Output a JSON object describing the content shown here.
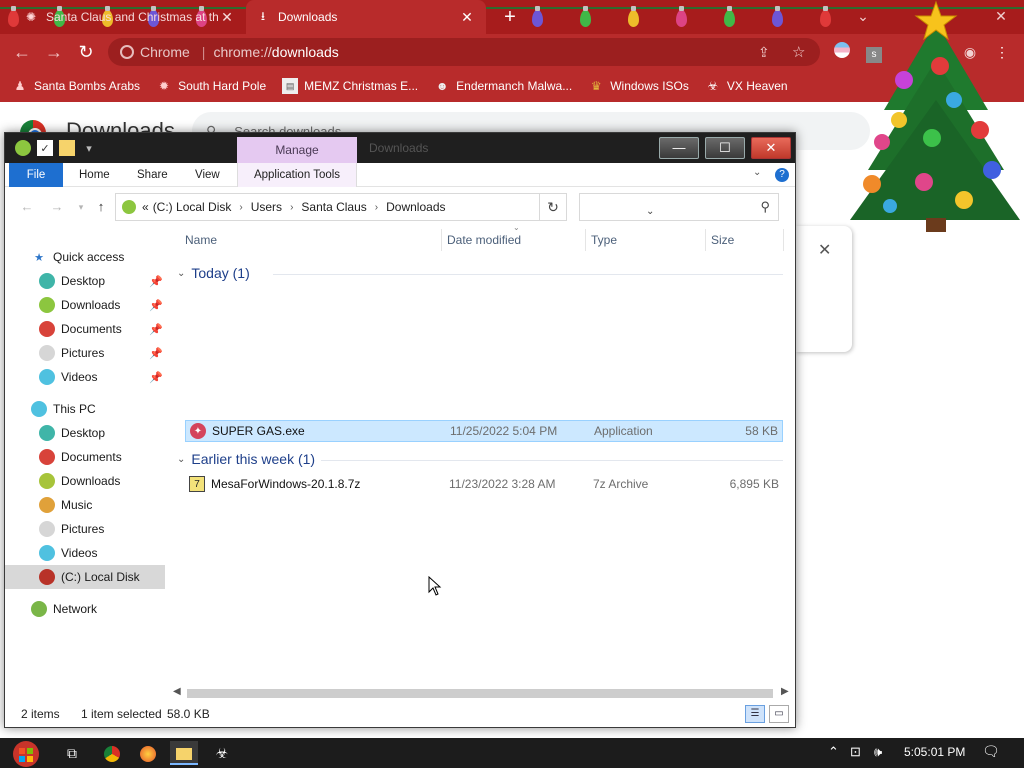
{
  "browser": {
    "tabs": [
      {
        "title": "Santa Claus and Christmas at th",
        "active": false
      },
      {
        "title": "Downloads",
        "active": true
      }
    ],
    "omnibox": {
      "chip": "Chrome",
      "url_scheme": "chrome://",
      "url_path": "downloads"
    },
    "bookmarks": [
      {
        "label": "Santa Bombs Arabs",
        "icon": "santa-icon"
      },
      {
        "label": "South Hard Pole",
        "icon": "gear-icon"
      },
      {
        "label": "MEMZ Christmas E...",
        "icon": "page-icon"
      },
      {
        "label": "Endermanch Malwa...",
        "icon": "raccoon-icon"
      },
      {
        "label": "Windows ISOs",
        "icon": "trophy-icon"
      },
      {
        "label": "VX Heaven",
        "icon": "biohazard-icon"
      }
    ],
    "page": {
      "title": "Downloads",
      "search_placeholder": "Search downloads"
    },
    "accent_color": "#b82b2b"
  },
  "explorer": {
    "window_title": "Downloads",
    "manage_label": "Manage",
    "ribbon": {
      "file": "File",
      "home": "Home",
      "share": "Share",
      "view": "View",
      "app_tools": "Application Tools"
    },
    "address": {
      "prefix": "«",
      "crumbs": [
        "(C:) Local Disk",
        "Users",
        "Santa Claus",
        "Downloads"
      ]
    },
    "nav": {
      "quick_access": "Quick access",
      "quick_items": [
        "Desktop",
        "Downloads",
        "Documents",
        "Pictures",
        "Videos"
      ],
      "this_pc": "This PC",
      "pc_items": [
        "Desktop",
        "Documents",
        "Downloads",
        "Music",
        "Pictures",
        "Videos",
        "(C:) Local Disk"
      ],
      "network": "Network"
    },
    "columns": {
      "name": "Name",
      "date": "Date modified",
      "type": "Type",
      "size": "Size"
    },
    "groups": [
      {
        "title": "Today (1)",
        "files": [
          {
            "name": "SUPER GAS.exe",
            "date": "11/25/2022 5:04 PM",
            "type": "Application",
            "size": "58 KB",
            "selected": true
          }
        ]
      },
      {
        "title": "Earlier this week (1)",
        "files": [
          {
            "name": "MesaForWindows-20.1.8.7z",
            "date": "11/23/2022 3:28 AM",
            "type": "7z Archive",
            "size": "6,895 KB",
            "selected": false
          }
        ]
      }
    ],
    "status": {
      "items": "2 items",
      "selected": "1 item selected",
      "size": "58.0 KB"
    }
  },
  "taskbar": {
    "time": "5:05:01 PM"
  }
}
